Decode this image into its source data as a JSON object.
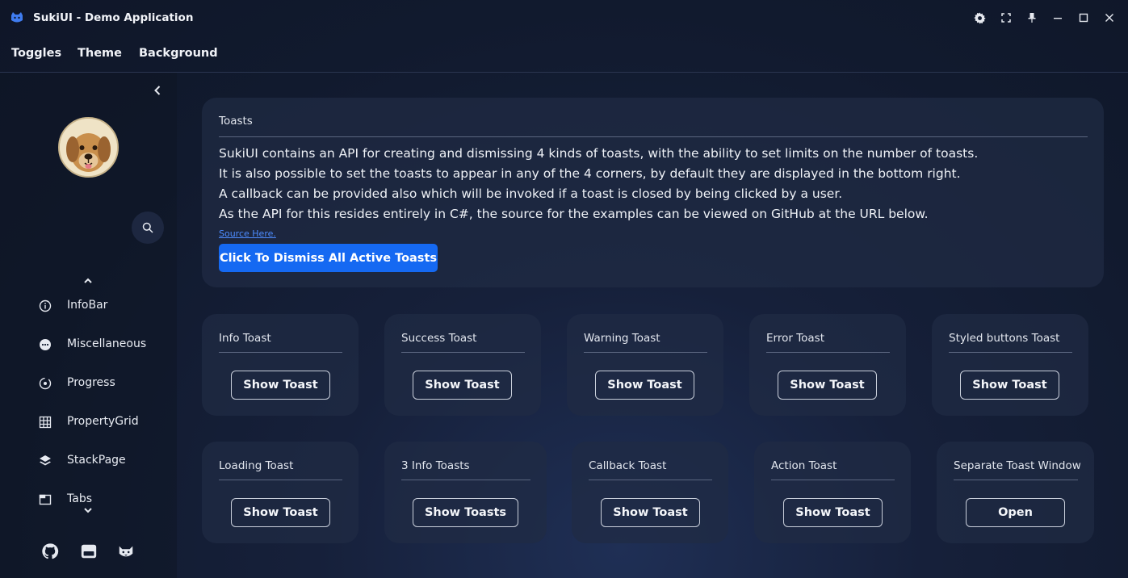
{
  "window": {
    "title": "SukiUI - Demo Application",
    "controls": [
      "gear-icon",
      "fullscreen-icon",
      "pin-icon",
      "minimize-icon",
      "maximize-icon",
      "close-icon"
    ]
  },
  "menu": {
    "items": [
      "Toggles",
      "Theme",
      "Background"
    ]
  },
  "sidebar": {
    "items": [
      {
        "label": "InfoBar",
        "icon": "info-icon"
      },
      {
        "label": "Miscellaneous",
        "icon": "dots-icon"
      },
      {
        "label": "Progress",
        "icon": "progress-icon"
      },
      {
        "label": "PropertyGrid",
        "icon": "grid-icon"
      },
      {
        "label": "StackPage",
        "icon": "layers-icon"
      },
      {
        "label": "Tabs",
        "icon": "tabs-icon"
      }
    ],
    "footer_icons": [
      "github-icon",
      "window-icon",
      "cat-icon"
    ]
  },
  "toasts_card": {
    "title": "Toasts",
    "lines": [
      "SukiUI contains an API for creating and dismissing 4 kinds of toasts, with the ability to set limits on the number of toasts.",
      "It is also possible to set the toasts to appear in any of the 4 corners, by default they are displayed in the bottom right.",
      "A callback can be provided also which will be invoked if a toast is closed by being clicked by a user.",
      "As the API for this resides entirely in C#, the source for the examples can be viewed on GitHub at the URL below."
    ],
    "link": "Source Here.",
    "dismiss_button": "Click To Dismiss All Active Toasts"
  },
  "toast_cards": [
    {
      "title": "Info Toast",
      "button": "Show Toast"
    },
    {
      "title": "Success Toast",
      "button": "Show Toast"
    },
    {
      "title": "Warning Toast",
      "button": "Show Toast"
    },
    {
      "title": "Error Toast",
      "button": "Show Toast"
    },
    {
      "title": "Styled buttons Toast",
      "button": "Show Toast"
    },
    {
      "title": "Loading Toast",
      "button": "Show Toast"
    },
    {
      "title": "3 Info Toasts",
      "button": "Show Toasts"
    },
    {
      "title": "Callback Toast",
      "button": "Show Toast"
    },
    {
      "title": "Action Toast",
      "button": "Show Toast"
    },
    {
      "title": "Separate Toast Window",
      "button": "Open"
    }
  ],
  "colors": {
    "accent": "#1569f2",
    "link": "#4d8cff",
    "card": "#202b44",
    "background": "#111a2e"
  }
}
